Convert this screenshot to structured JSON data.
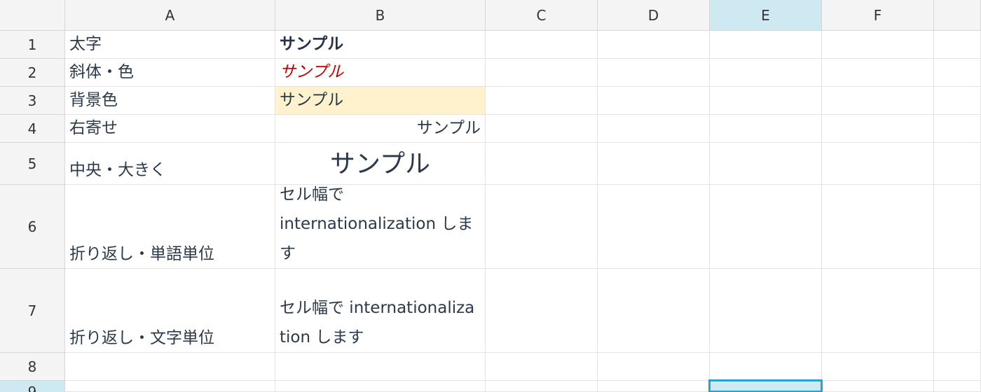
{
  "columns": [
    "A",
    "B",
    "C",
    "D",
    "E",
    "F"
  ],
  "rows": [
    "1",
    "2",
    "3",
    "4",
    "5",
    "6",
    "7",
    "8",
    "9"
  ],
  "cells": {
    "A1": "太字",
    "B1": "サンプル",
    "A2": "斜体・色",
    "B2": "サンプル",
    "A3": "背景色",
    "B3": "サンプル",
    "A4": "右寄せ",
    "B4": "サンプル",
    "A5": "中央・大きく",
    "B5": "サンプル",
    "A6": "折り返し・単語単位",
    "B6": "セル幅で internationalization します",
    "A7": "折り返し・文字単位",
    "B7": "セル幅で internationalization します"
  },
  "selected": {
    "column": "E",
    "row": "9"
  },
  "colors": {
    "italic_text": "#c00000",
    "highlight_background": "#fff2cc",
    "selection_fill": "#cfe9f3",
    "selection_border": "#27a3d3"
  }
}
